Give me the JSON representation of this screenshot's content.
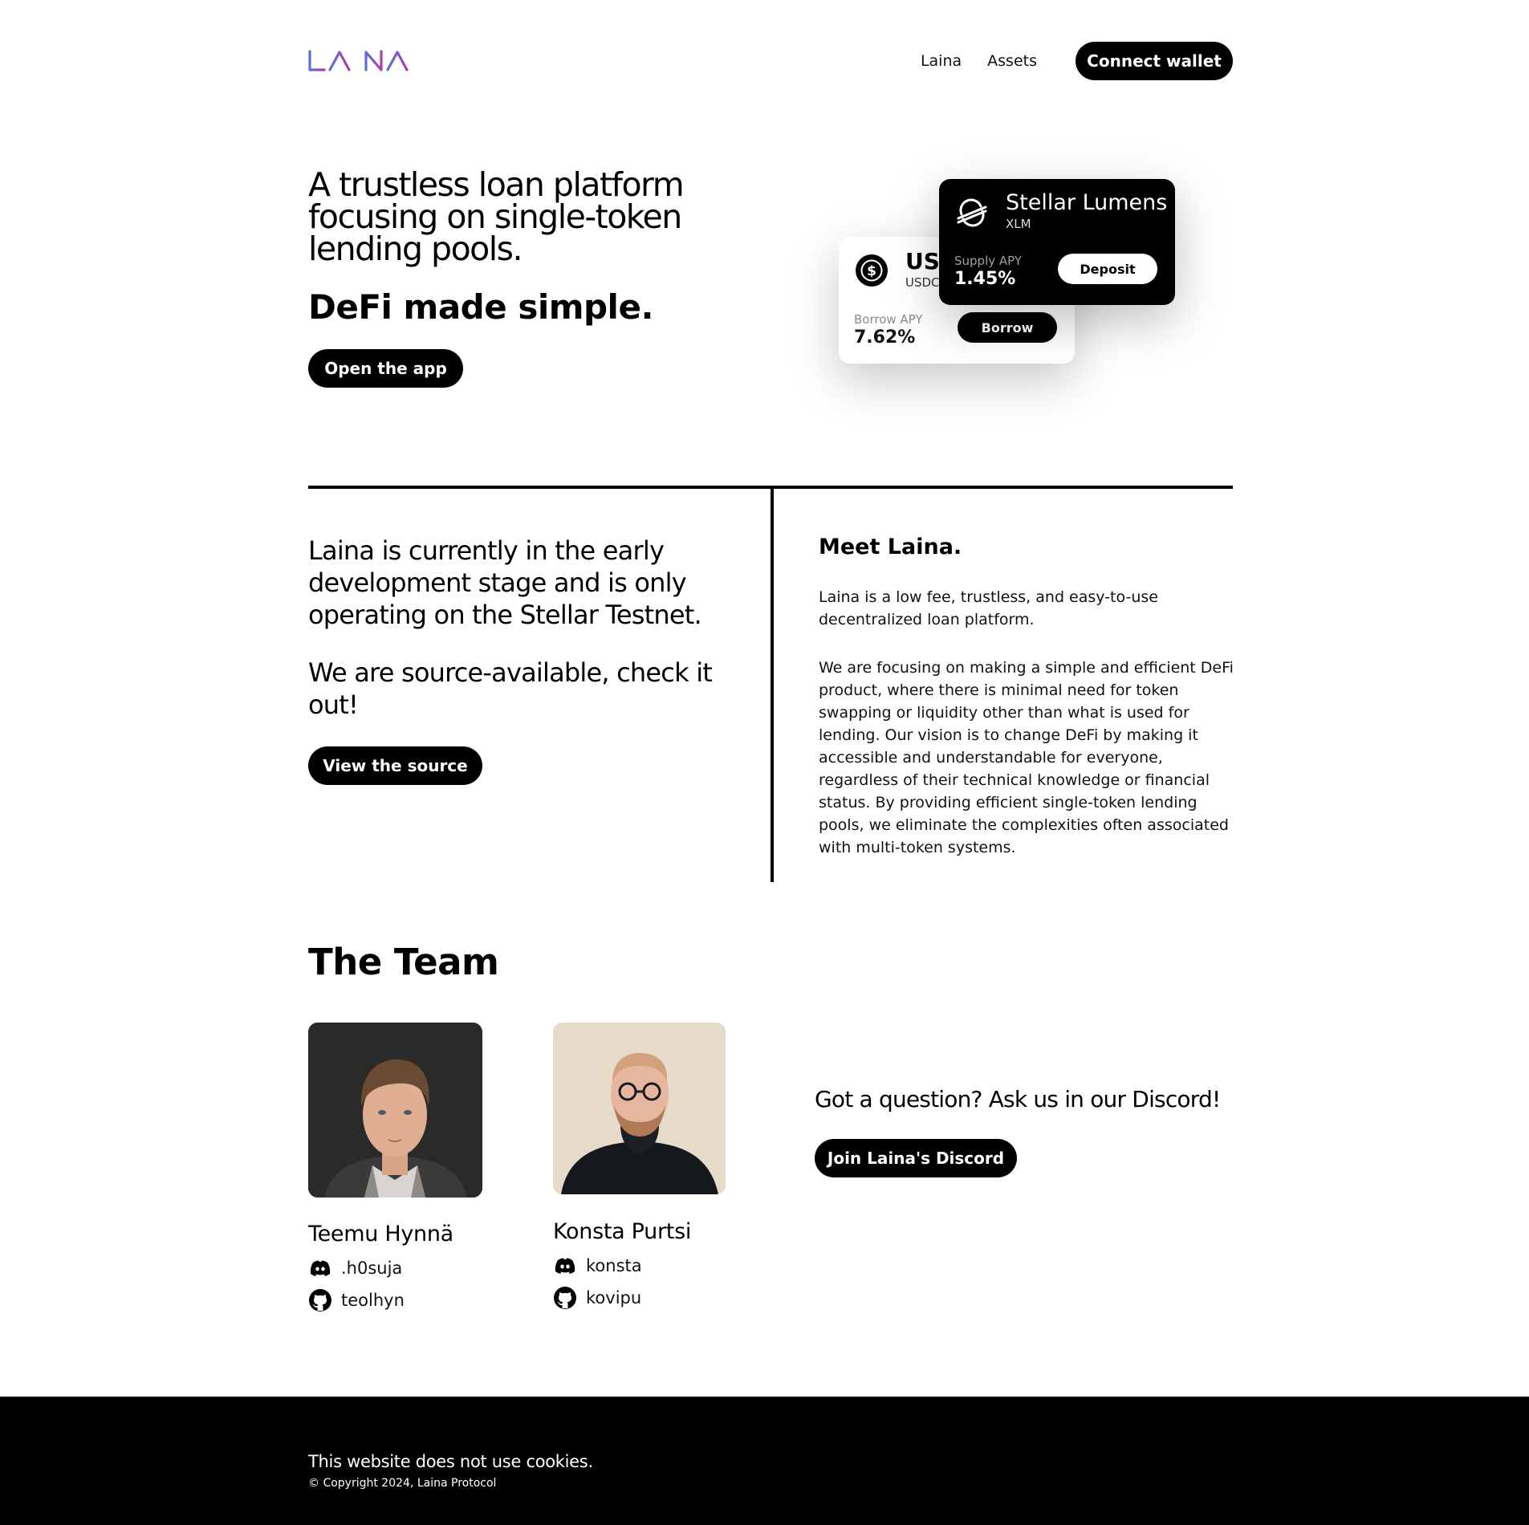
{
  "brand": {
    "logo_text": "LAINA"
  },
  "nav": {
    "items": [
      "Laina",
      "Assets"
    ],
    "connect_label": "Connect wallet"
  },
  "hero": {
    "title": "A trustless loan platform focusing on single-token lending pools.",
    "subtitle": "DeFi made simple.",
    "cta_label": "Open the app"
  },
  "cards": {
    "usdc": {
      "name": "USDC",
      "ticker": "USDC",
      "rate_label": "Borrow APY",
      "rate_value": "7.62%",
      "button_label": "Borrow",
      "icon": "usdc-icon"
    },
    "xlm": {
      "name": "Stellar Lumens",
      "ticker": "XLM",
      "rate_label": "Supply APY",
      "rate_value": "1.45%",
      "button_label": "Deposit",
      "icon": "stellar-icon"
    }
  },
  "status": {
    "text1": "Laina is currently in the early development stage and is only operating on the Stellar Testnet.",
    "text2": "We are source-available, check it out!",
    "button_label": "View the source"
  },
  "meet": {
    "title": "Meet Laina.",
    "p1": "Laina is a low fee, trustless, and easy-to-use decentralized loan platform.",
    "p2": "We are focusing on making a simple and efficient DeFi product, where there is minimal need for token swapping or liquidity other than what is used for lending. Our vision is to change DeFi by making it accessible and understandable for everyone, regardless of their technical knowledge or financial status. By providing efficient single-token lending pools, we eliminate the complexities often associated with multi-token systems."
  },
  "team": {
    "title": "The Team",
    "members": [
      {
        "name": "Teemu Hynnä",
        "discord": ".h0suja",
        "github": "teolhyn"
      },
      {
        "name": "Konsta Purtsi",
        "discord": "konsta",
        "github": "kovipu"
      }
    ]
  },
  "discord": {
    "question": "Got a question? Ask us in our Discord!",
    "button_label": "Join Laina's Discord"
  },
  "footer": {
    "cookies": "This website does not use cookies.",
    "copyright": "© Copyright 2024, Laina Protocol"
  },
  "colors": {
    "logo_gradient_start": "#5b6fd6",
    "logo_gradient_end": "#b23ca8",
    "primary": "#000000"
  }
}
